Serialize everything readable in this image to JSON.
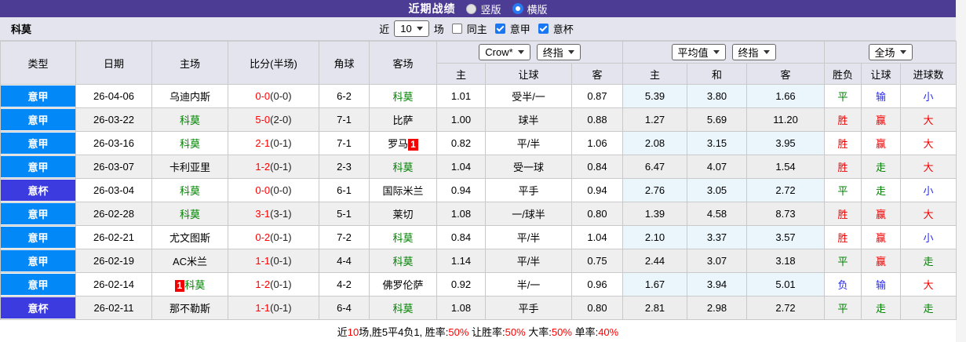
{
  "topbar": {
    "title": "近期战绩",
    "radio_vertical": "竖版",
    "radio_horizontal": "横版",
    "selected": "横版",
    "bg_color": "#4D3C94"
  },
  "filter": {
    "team": "科莫",
    "recent_label": "近",
    "recent_value": "10",
    "matches_label": "场",
    "same_home_label": "同主",
    "same_home_checked": false,
    "league1_label": "意甲",
    "league1_checked": true,
    "league2_label": "意杯",
    "league2_checked": true
  },
  "table": {
    "selects": {
      "asia_company": "Crow*",
      "asia_final": "终指",
      "europe_avg": "平均值",
      "europe_final": "终指",
      "scope": "全场"
    },
    "headers": {
      "type": "类型",
      "date": "日期",
      "home": "主场",
      "score": "比分(半场)",
      "corner": "角球",
      "away": "客场",
      "asia_home": "主",
      "asia_line": "让球",
      "asia_away": "客",
      "eu_home": "主",
      "eu_draw": "和",
      "eu_away": "客",
      "result": "胜负",
      "handicap_result": "让球",
      "goals": "进球数"
    },
    "league_colors": {
      "意甲": "#0289F7",
      "意杯": "#3B3BE0"
    },
    "verdict_colors": {
      "胜": "red",
      "平": "grn",
      "负": "blu",
      "赢": "red",
      "输": "blu",
      "走": "grn",
      "大": "red",
      "小": "blu"
    },
    "highlight_team_color": "#008000",
    "rows": [
      {
        "league": "意甲",
        "date": "26-04-06",
        "home": "乌迪内斯",
        "home_hl": false,
        "home_badge": "",
        "home_badge_pos": "",
        "ft": "0-0",
        "ht": "(0-0)",
        "corner": "6-2",
        "away": "科莫",
        "away_hl": true,
        "away_badge": "",
        "away_badge_pos": "",
        "asia": [
          "1.01",
          "受半/一",
          "0.87"
        ],
        "europe": [
          "5.39",
          "3.80",
          "1.66"
        ],
        "result": "平",
        "handicap": "输",
        "goals": "小"
      },
      {
        "league": "意甲",
        "date": "26-03-22",
        "home": "科莫",
        "home_hl": true,
        "home_badge": "",
        "home_badge_pos": "",
        "ft": "5-0",
        "ht": "(2-0)",
        "corner": "7-1",
        "away": "比萨",
        "away_hl": false,
        "away_badge": "",
        "away_badge_pos": "",
        "asia": [
          "1.00",
          "球半",
          "0.88"
        ],
        "europe": [
          "1.27",
          "5.69",
          "11.20"
        ],
        "result": "胜",
        "handicap": "赢",
        "goals": "大"
      },
      {
        "league": "意甲",
        "date": "26-03-16",
        "home": "科莫",
        "home_hl": true,
        "home_badge": "",
        "home_badge_pos": "",
        "ft": "2-1",
        "ht": "(0-1)",
        "corner": "7-1",
        "away": "罗马",
        "away_hl": false,
        "away_badge": "1",
        "away_badge_pos": "after",
        "asia": [
          "0.82",
          "平/半",
          "1.06"
        ],
        "europe": [
          "2.08",
          "3.15",
          "3.95"
        ],
        "result": "胜",
        "handicap": "赢",
        "goals": "大"
      },
      {
        "league": "意甲",
        "date": "26-03-07",
        "home": "卡利亚里",
        "home_hl": false,
        "home_badge": "",
        "home_badge_pos": "",
        "ft": "1-2",
        "ht": "(0-1)",
        "corner": "2-3",
        "away": "科莫",
        "away_hl": true,
        "away_badge": "",
        "away_badge_pos": "",
        "asia": [
          "1.04",
          "受一球",
          "0.84"
        ],
        "europe": [
          "6.47",
          "4.07",
          "1.54"
        ],
        "result": "胜",
        "handicap": "走",
        "goals": "大"
      },
      {
        "league": "意杯",
        "date": "26-03-04",
        "home": "科莫",
        "home_hl": true,
        "home_badge": "",
        "home_badge_pos": "",
        "ft": "0-0",
        "ht": "(0-0)",
        "corner": "6-1",
        "away": "国际米兰",
        "away_hl": false,
        "away_badge": "",
        "away_badge_pos": "",
        "asia": [
          "0.94",
          "平手",
          "0.94"
        ],
        "europe": [
          "2.76",
          "3.05",
          "2.72"
        ],
        "result": "平",
        "handicap": "走",
        "goals": "小"
      },
      {
        "league": "意甲",
        "date": "26-02-28",
        "home": "科莫",
        "home_hl": true,
        "home_badge": "",
        "home_badge_pos": "",
        "ft": "3-1",
        "ht": "(3-1)",
        "corner": "5-1",
        "away": "莱切",
        "away_hl": false,
        "away_badge": "",
        "away_badge_pos": "",
        "asia": [
          "1.08",
          "一/球半",
          "0.80"
        ],
        "europe": [
          "1.39",
          "4.58",
          "8.73"
        ],
        "result": "胜",
        "handicap": "赢",
        "goals": "大"
      },
      {
        "league": "意甲",
        "date": "26-02-21",
        "home": "尤文图斯",
        "home_hl": false,
        "home_badge": "",
        "home_badge_pos": "",
        "ft": "0-2",
        "ht": "(0-1)",
        "corner": "7-2",
        "away": "科莫",
        "away_hl": true,
        "away_badge": "",
        "away_badge_pos": "",
        "asia": [
          "0.84",
          "平/半",
          "1.04"
        ],
        "europe": [
          "2.10",
          "3.37",
          "3.57"
        ],
        "result": "胜",
        "handicap": "赢",
        "goals": "小"
      },
      {
        "league": "意甲",
        "date": "26-02-19",
        "home": "AC米兰",
        "home_hl": false,
        "home_badge": "",
        "home_badge_pos": "",
        "ft": "1-1",
        "ht": "(0-1)",
        "corner": "4-4",
        "away": "科莫",
        "away_hl": true,
        "away_badge": "",
        "away_badge_pos": "",
        "asia": [
          "1.14",
          "平/半",
          "0.75"
        ],
        "europe": [
          "2.44",
          "3.07",
          "3.18"
        ],
        "result": "平",
        "handicap": "赢",
        "goals": "走"
      },
      {
        "league": "意甲",
        "date": "26-02-14",
        "home": "科莫",
        "home_hl": true,
        "home_badge": "1",
        "home_badge_pos": "before",
        "ft": "1-2",
        "ht": "(0-1)",
        "corner": "4-2",
        "away": "佛罗伦萨",
        "away_hl": false,
        "away_badge": "",
        "away_badge_pos": "",
        "asia": [
          "0.92",
          "半/一",
          "0.96"
        ],
        "europe": [
          "1.67",
          "3.94",
          "5.01"
        ],
        "result": "负",
        "handicap": "输",
        "goals": "大"
      },
      {
        "league": "意杯",
        "date": "26-02-11",
        "home": "那不勒斯",
        "home_hl": false,
        "home_badge": "",
        "home_badge_pos": "",
        "ft": "1-1",
        "ht": "(0-1)",
        "corner": "6-4",
        "away": "科莫",
        "away_hl": true,
        "away_badge": "",
        "away_badge_pos": "",
        "asia": [
          "1.08",
          "平手",
          "0.80"
        ],
        "europe": [
          "2.81",
          "2.98",
          "2.72"
        ],
        "result": "平",
        "handicap": "走",
        "goals": "走"
      }
    ]
  },
  "footer": {
    "segments": [
      {
        "text": "近",
        "red": false
      },
      {
        "text": "10",
        "red": true
      },
      {
        "text": "场,胜5平4负1, 胜率:",
        "red": false
      },
      {
        "text": "50%",
        "red": true
      },
      {
        "text": " 让胜率:",
        "red": false
      },
      {
        "text": "50%",
        "red": true
      },
      {
        "text": " 大率:",
        "red": false
      },
      {
        "text": "50%",
        "red": true
      },
      {
        "text": " 单率:",
        "red": false
      },
      {
        "text": "40%",
        "red": true
      }
    ]
  }
}
